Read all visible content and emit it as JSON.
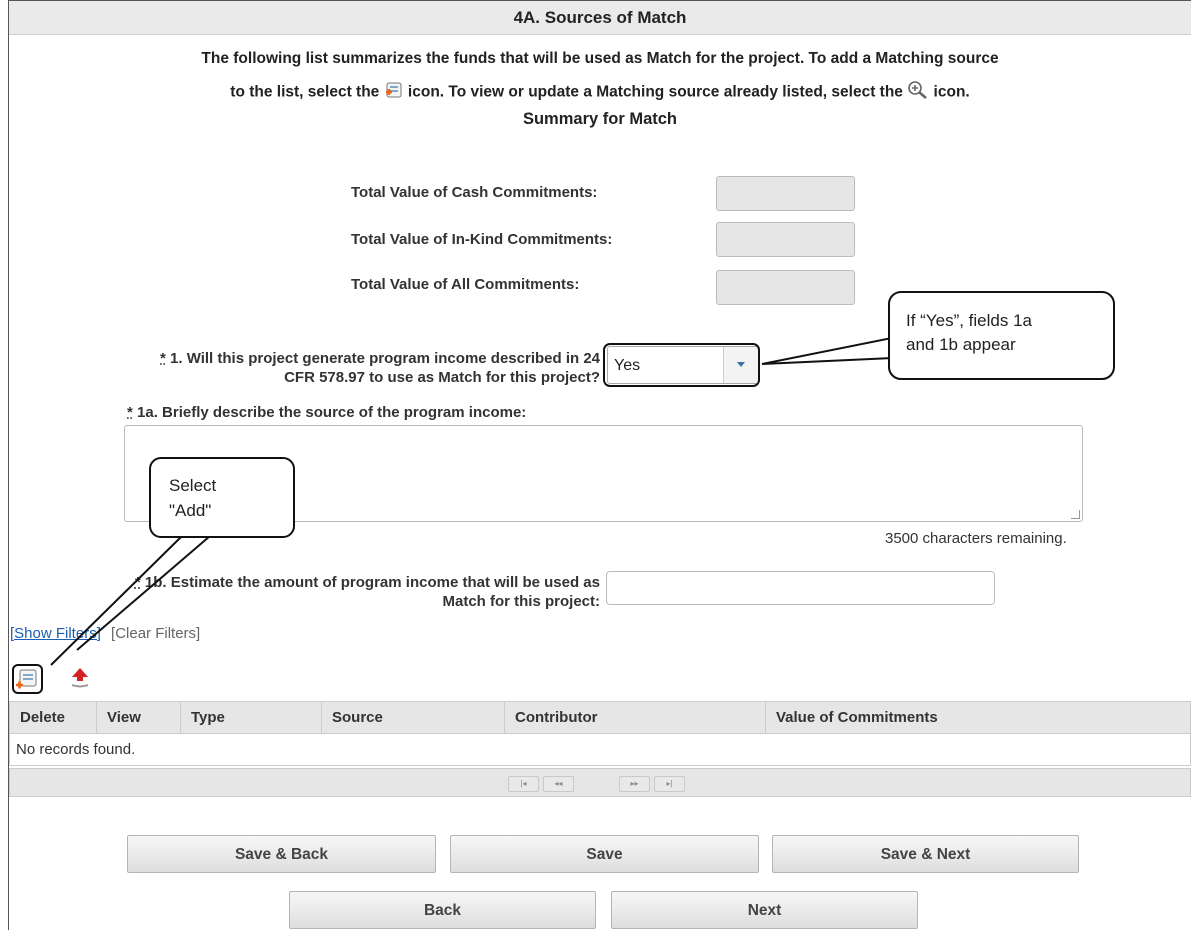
{
  "header": {
    "title": "4A. Sources of Match"
  },
  "intro": {
    "line1": "The following list summarizes the funds that will be used as Match for the project. To add a Matching source",
    "line2_a": "to the list, select the",
    "line2_b": "icon. To view or update a Matching source already listed, select the",
    "line2_c": "icon.",
    "add_icon": "add-record-icon",
    "view_icon": "magnifier-plus-icon"
  },
  "summary": {
    "title": "Summary for Match",
    "cash_label": "Total Value of Cash Commitments:",
    "inkind_label": "Total Value of In-Kind Commitments:",
    "all_label": "Total Value of All Commitments:"
  },
  "q1": {
    "required": "*",
    "line1": "1. Will this project generate program income described in 24",
    "line2": "CFR 578.97 to use as Match for this project?",
    "value": "Yes"
  },
  "q1a": {
    "required": "*",
    "label": "1a. Briefly describe the source of the program income:",
    "chars_remaining": "3500 characters remaining."
  },
  "q1b": {
    "required": "*",
    "line1": "1b. Estimate the amount of program income that will be used as",
    "line2": "Match for this project:"
  },
  "filters": {
    "show": "[Show Filters]",
    "clear": "[Clear Filters]"
  },
  "toolbar": {
    "add_icon": "add-record-icon",
    "export_icon": "upload-icon"
  },
  "grid": {
    "columns": [
      "Delete",
      "View",
      "Type",
      "Source",
      "Contributor",
      "Value of Commitments"
    ],
    "empty": "No records found."
  },
  "pager": [
    "|◂",
    "◂◂",
    "▸▸",
    "▸|"
  ],
  "buttons": {
    "save_back": "Save & Back",
    "save": "Save",
    "save_next": "Save & Next",
    "back": "Back",
    "next": "Next"
  },
  "callouts": {
    "yes_note_1": "If “Yes”, fields 1a",
    "yes_note_2": "and 1b appear",
    "add_note_1": "Select",
    "add_note_2": "\"Add\""
  }
}
